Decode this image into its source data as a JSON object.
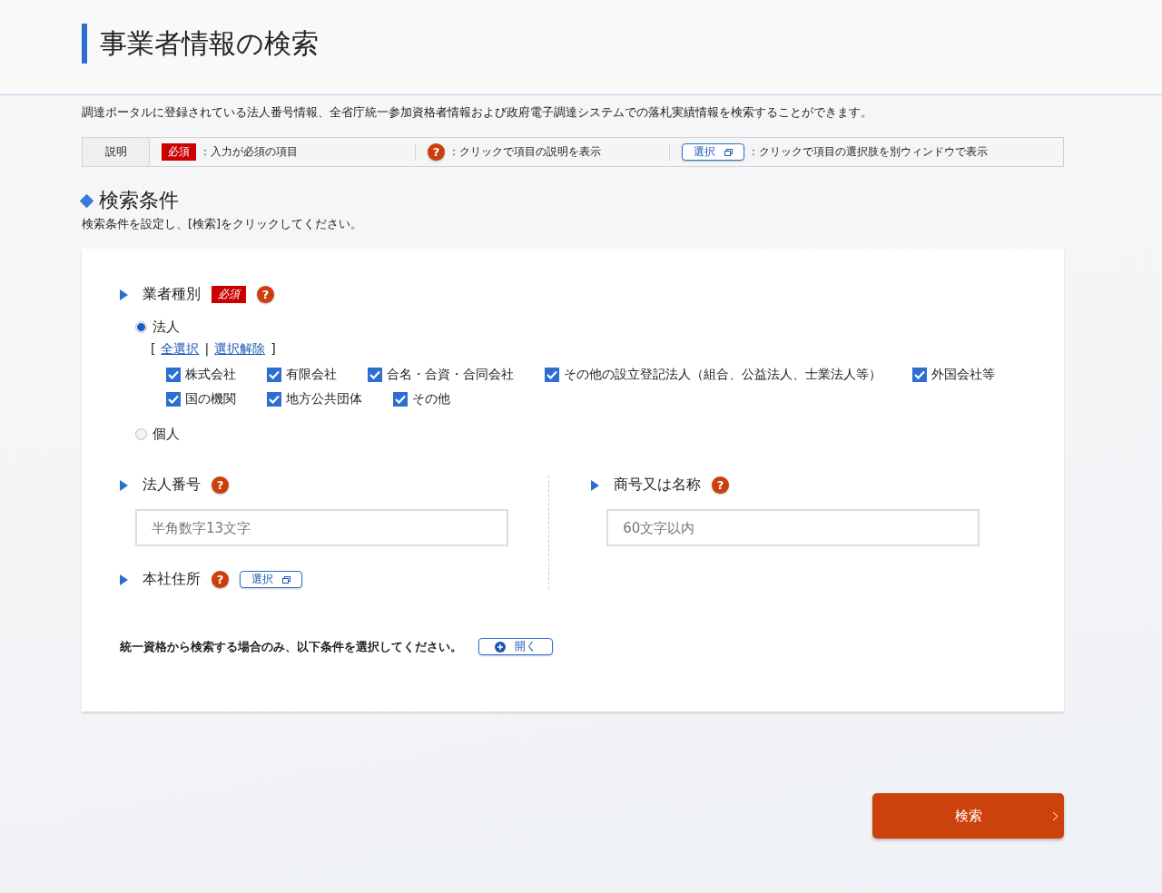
{
  "page_title": "事業者情報の検索",
  "description": "調達ポータルに登録されている法人番号情報、全省庁統一参加資格者情報および政府電子調達システムでの落札実績情報を検索することができます。",
  "legend": {
    "label": "説明",
    "required_badge": "必須",
    "required_text": "：入力が必須の項目",
    "help_icon": "?",
    "help_text": "：クリックで項目の説明を表示",
    "select_button": "選択",
    "select_text": "：クリックで項目の選択肢を別ウィンドウで表示"
  },
  "section": {
    "title": "検索条件",
    "subtitle": "検索条件を設定し、[検索]をクリックしてください。"
  },
  "business_type": {
    "label": "業者種別",
    "required_badge": "必須",
    "help_icon": "?",
    "options": [
      {
        "label": "法人",
        "selected": true,
        "open_bracket": "[",
        "select_all": "全選択",
        "separator": "|",
        "deselect_all": "選択解除",
        "close_bracket": "]",
        "checkboxes": [
          {
            "label": "株式会社",
            "checked": true
          },
          {
            "label": "有限会社",
            "checked": true
          },
          {
            "label": "合名・合資・合同会社",
            "checked": true
          },
          {
            "label": "その他の設立登記法人（組合、公益法人、士業法人等）",
            "checked": true
          },
          {
            "label": "外国会社等",
            "checked": true
          },
          {
            "label": "国の機関",
            "checked": true
          },
          {
            "label": "地方公共団体",
            "checked": true
          },
          {
            "label": "その他",
            "checked": true
          }
        ]
      },
      {
        "label": "個人",
        "selected": false
      }
    ]
  },
  "corporate_number": {
    "label": "法人番号",
    "help_icon": "?",
    "placeholder": "半角数字13文字"
  },
  "trade_name": {
    "label": "商号又は名称",
    "help_icon": "?",
    "placeholder": "60文字以内"
  },
  "head_office": {
    "label": "本社住所",
    "help_icon": "?",
    "select_button": "選択"
  },
  "unified_qualification": {
    "text": "統一資格から検索する場合のみ、以下条件を選択してください。",
    "button": "開く"
  },
  "search_button": "検索"
}
